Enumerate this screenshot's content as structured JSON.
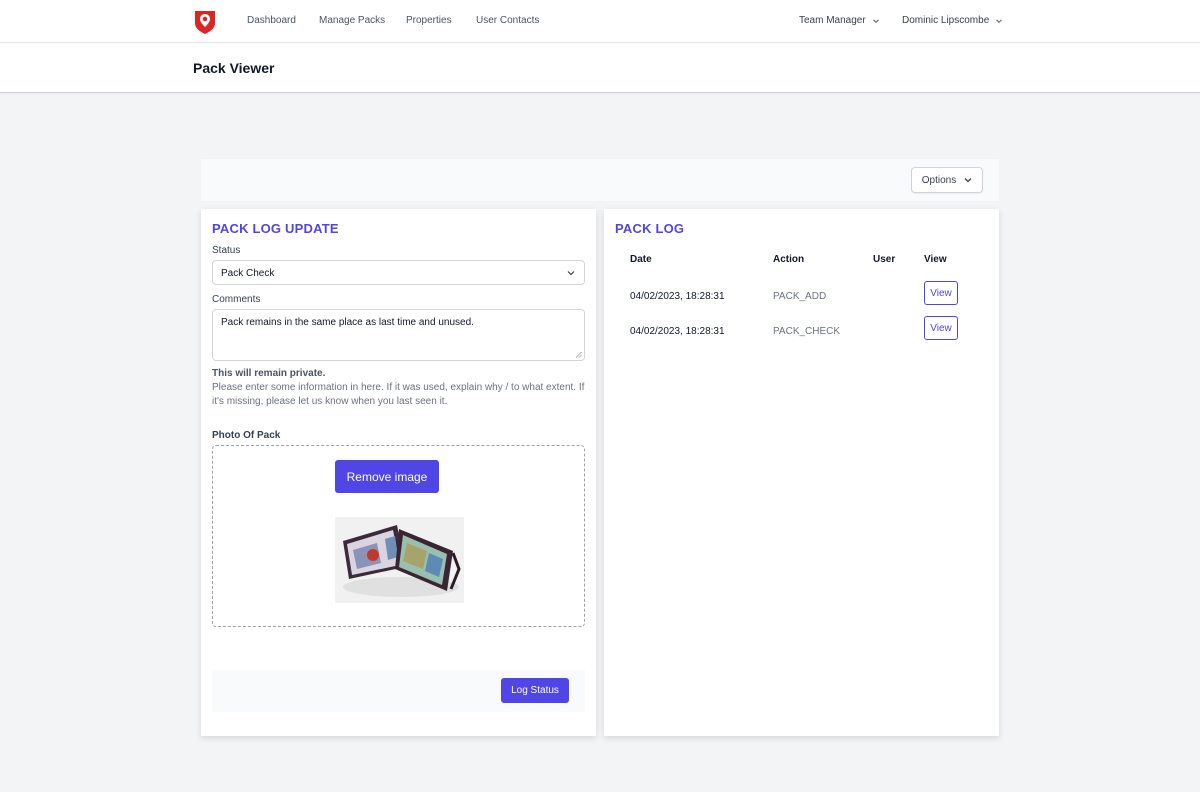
{
  "nav": {
    "links": [
      "Dashboard",
      "Manage Packs",
      "Properties",
      "User Contacts"
    ],
    "team_menu": "Team Manager",
    "user_menu": "Dominic Lipscombe"
  },
  "page": {
    "title": "Pack Viewer"
  },
  "options": {
    "label": "Options"
  },
  "update": {
    "title": "PACK LOG UPDATE",
    "status_label": "Status",
    "status_value": "Pack Check",
    "comments_label": "Comments",
    "comments_value": "Pack remains in the same place as last time and unused.",
    "private_note": "This will remain private.",
    "help_text": "Please enter some information in here. If it was used, explain why / to what extent. If it's missing, please let us know when you last seen it.",
    "photo_label": "Photo Of Pack",
    "remove_label": "Remove image",
    "submit_label": "Log Status"
  },
  "log": {
    "title": "PACK LOG",
    "columns": [
      "Date",
      "Action",
      "User",
      "View"
    ],
    "rows": [
      {
        "date": "04/02/2023, 18:28:31",
        "action": "PACK_ADD",
        "user": "",
        "view": "View"
      },
      {
        "date": "04/02/2023, 18:28:31",
        "action": "PACK_CHECK",
        "user": "",
        "view": "View"
      }
    ]
  },
  "colors": {
    "accent": "#4f46e5",
    "logo_red": "#dc2626"
  },
  "icons": {
    "logo": "pin-shield-logo",
    "dropdown": "chevron-down-icon",
    "resize": "resize-grip-icon"
  }
}
